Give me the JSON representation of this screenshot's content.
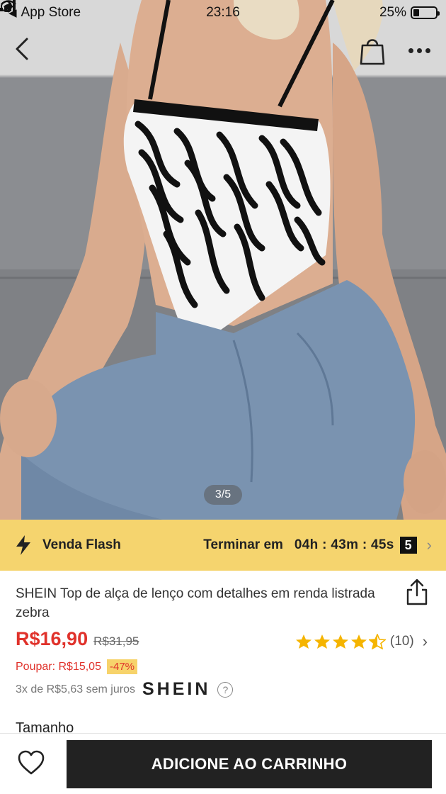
{
  "status_bar": {
    "back_app": "App Store",
    "time": "23:16",
    "battery": "25%"
  },
  "gallery": {
    "pager": "3/5"
  },
  "flash_sale": {
    "label": "Venda Flash",
    "ends_label": "Terminar em",
    "timer": "04h : 43m : 45s",
    "count": "5"
  },
  "product": {
    "title": "SHEIN Top de alça de lenço com detalhes em renda listrada zebra",
    "price": "R$16,90",
    "original_price": "R$31,95",
    "savings": "Poupar: R$15,05",
    "discount": "-47%",
    "installments": "3x de R$5,63 sem juros",
    "brand": "SHEIN",
    "rating_stars": 4.5,
    "rating_count": "(10)",
    "size_label": "Tamanho"
  },
  "actions": {
    "add_to_cart": "ADICIONE AO CARRINHO"
  },
  "colors": {
    "accent_red": "#e0322b",
    "flash_yellow": "#f5d46e",
    "star_gold": "#f5b400",
    "button_dark": "#222222"
  }
}
